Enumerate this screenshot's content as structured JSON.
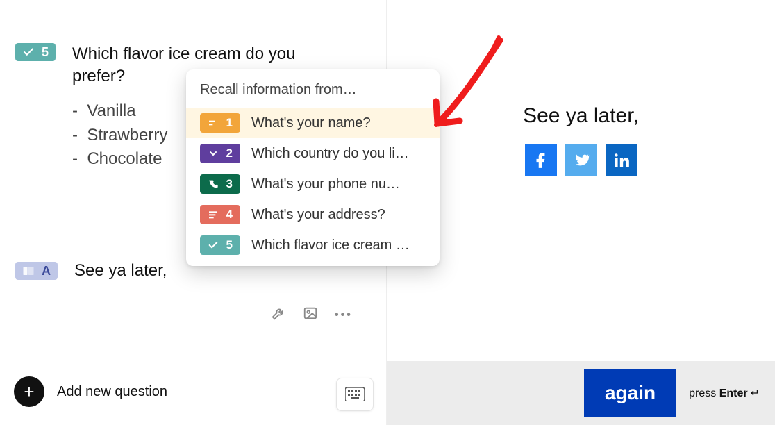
{
  "left": {
    "question": {
      "badge_number": "5",
      "text": "Which flavor ice cream do you prefer?",
      "options": [
        "Vanilla",
        "Strawberry",
        "Chocolate"
      ]
    },
    "thankyou": {
      "badge_letter": "A",
      "text": "See ya later,"
    },
    "add_button_label": "Add new question"
  },
  "popover": {
    "title": "Recall information from…",
    "items": [
      {
        "num": "1",
        "label": "What's your name?",
        "color": "orange",
        "icon": "short-text",
        "highlight": true
      },
      {
        "num": "2",
        "label": "Which country do you li…",
        "color": "purple",
        "icon": "chevron-down",
        "highlight": false
      },
      {
        "num": "3",
        "label": "What's your phone nu…",
        "color": "green",
        "icon": "phone",
        "highlight": false
      },
      {
        "num": "4",
        "label": "What's your address?",
        "color": "coral",
        "icon": "long-text",
        "highlight": false
      },
      {
        "num": "5",
        "label": "Which flavor ice cream …",
        "color": "teal",
        "icon": "check",
        "highlight": false
      }
    ]
  },
  "preview": {
    "headline": "See ya later,",
    "button_label": "again",
    "hint_prefix": "press ",
    "hint_key": "Enter",
    "hint_symbol": "↵"
  },
  "icons": {
    "checkmark": "checkmark-icon",
    "end_screen": "end-screen-icon",
    "wrench": "wrench-icon",
    "image": "image-icon",
    "more": "more-icon",
    "plus": "plus-icon",
    "keyboard": "keyboard-icon",
    "chevron_down": "chevron-down-icon",
    "phone": "phone-icon",
    "short_text": "short-text-icon",
    "long_text": "long-text-icon",
    "facebook": "facebook-icon",
    "twitter": "twitter-icon",
    "linkedin": "linkedin-icon"
  },
  "colors": {
    "teal": "#5DB0AC",
    "orange": "#F2A53A",
    "purple": "#5F3E9E",
    "green": "#0C6B4B",
    "coral": "#E46C5D",
    "primary_blue": "#003BB5",
    "annotation_red": "#EF1C1C"
  }
}
